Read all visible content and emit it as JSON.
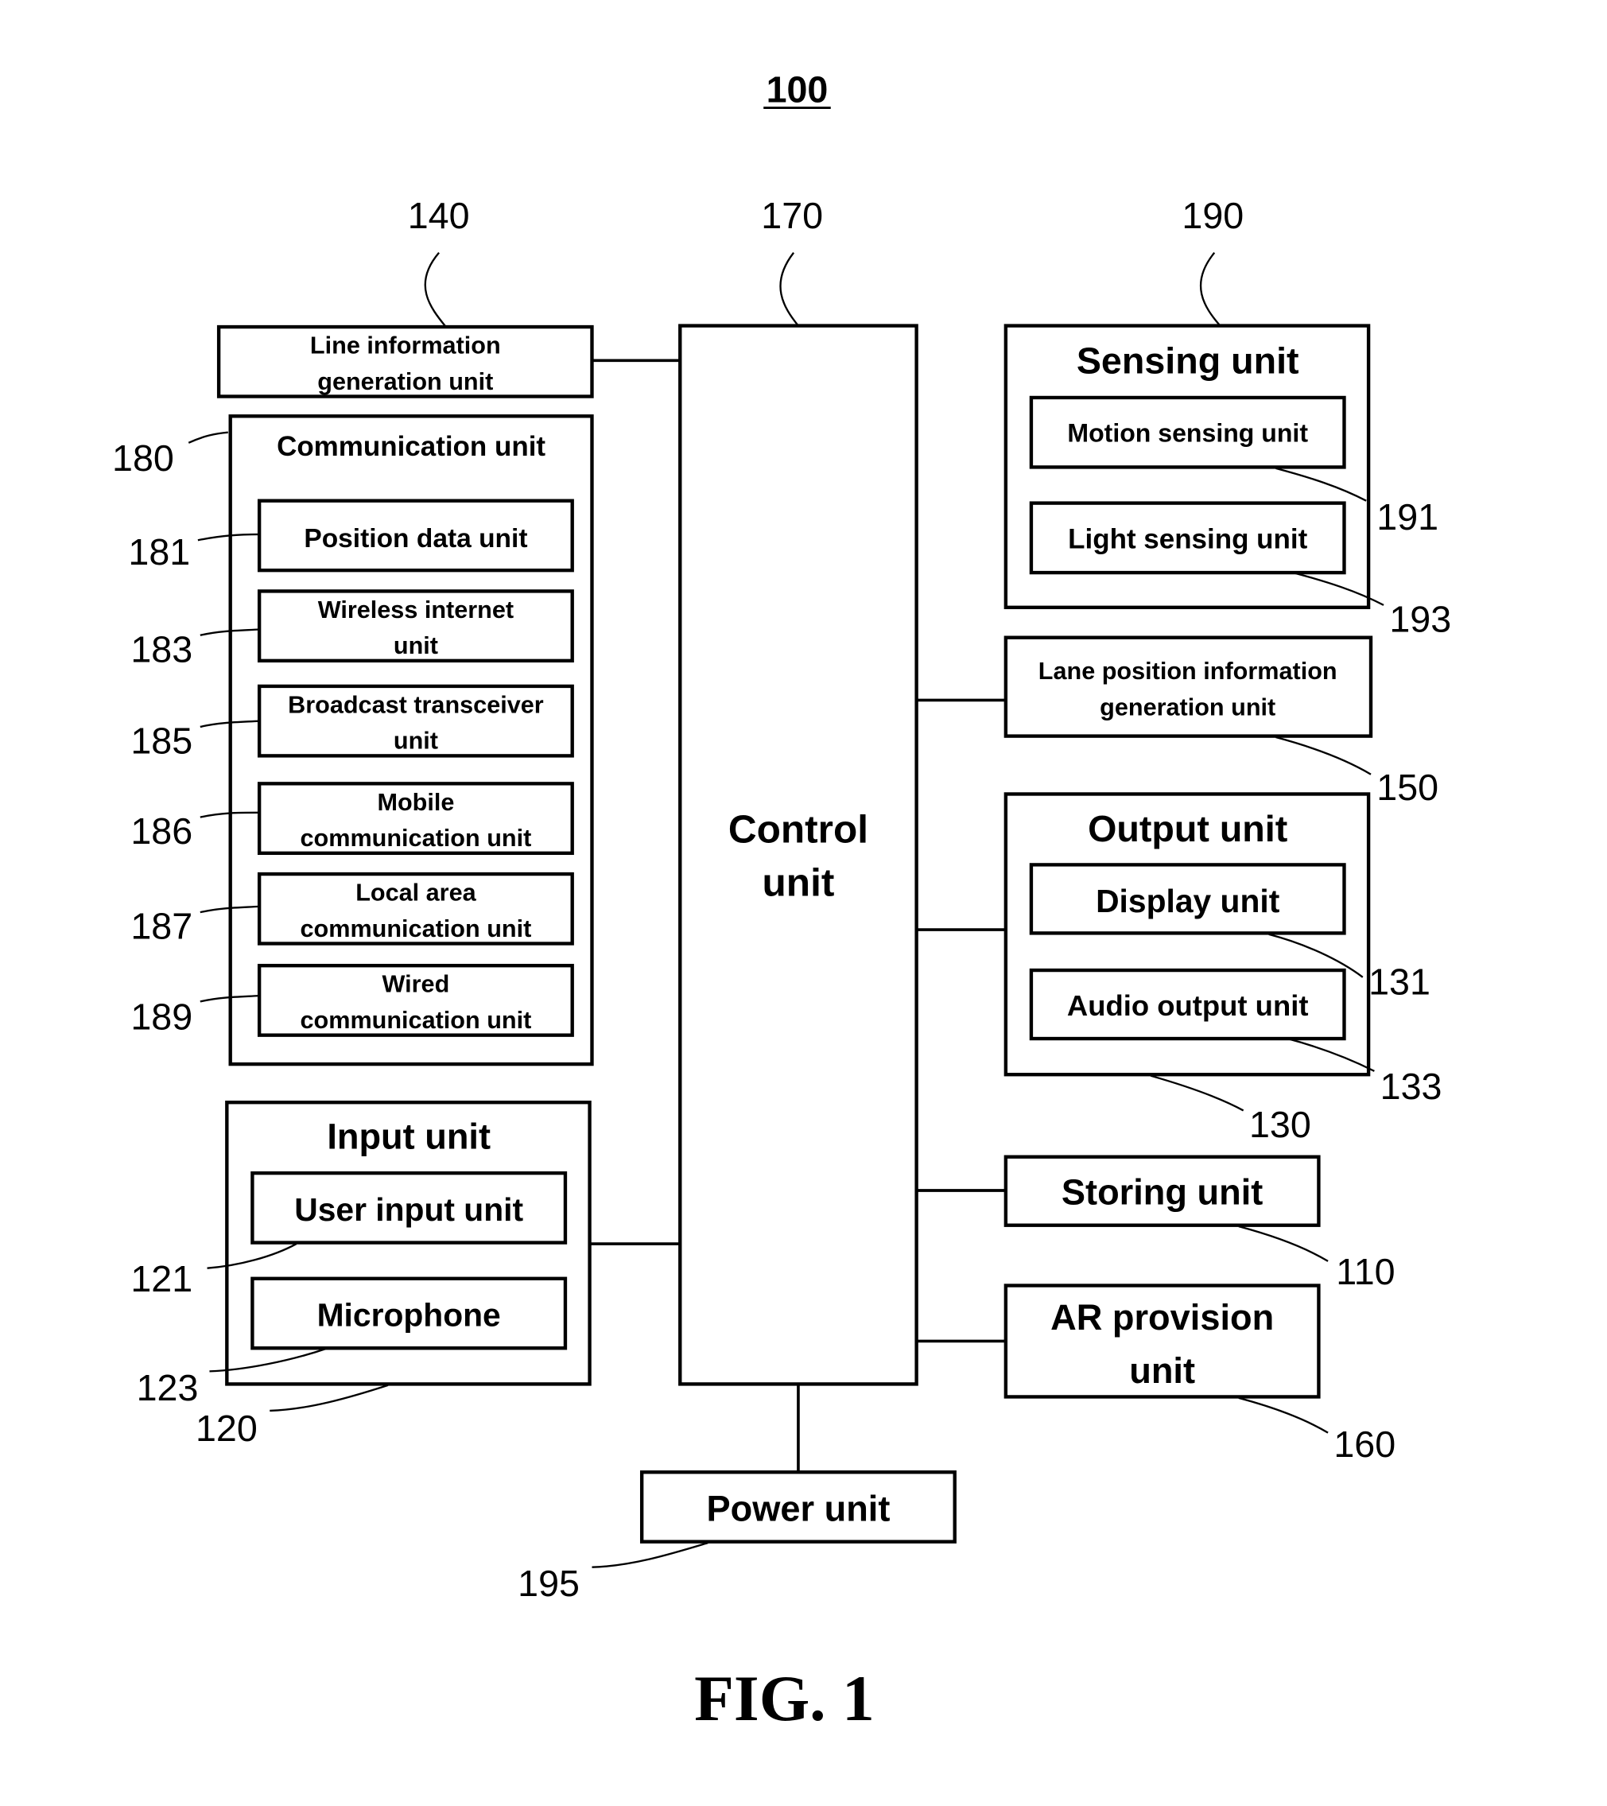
{
  "title": "100",
  "caption": "FIG. 1",
  "refs": {
    "r140": "140",
    "r170": "170",
    "r190": "190",
    "r180": "180",
    "r181": "181",
    "r183": "183",
    "r185": "185",
    "r186": "186",
    "r187": "187",
    "r189": "189",
    "r191": "191",
    "r193": "193",
    "r150": "150",
    "r131": "131",
    "r133": "133",
    "r130": "130",
    "r110": "110",
    "r160": "160",
    "r121": "121",
    "r123": "123",
    "r120": "120",
    "r195": "195"
  },
  "blocks": {
    "line_info": [
      "Line information",
      "generation unit"
    ],
    "communication": "Communication unit",
    "position_data": "Position data unit",
    "wireless": [
      "Wireless internet",
      "unit"
    ],
    "broadcast": [
      "Broadcast transceiver",
      "unit"
    ],
    "mobile": [
      "Mobile",
      "communication unit"
    ],
    "local_area": [
      "Local area",
      "communication unit"
    ],
    "wired": [
      "Wired",
      "communication unit"
    ],
    "input": "Input unit",
    "user_input": "User input unit",
    "microphone": "Microphone",
    "control": [
      "Control",
      "unit"
    ],
    "sensing": "Sensing unit",
    "motion": "Motion sensing unit",
    "light": "Light sensing unit",
    "lane_pos": [
      "Lane position information",
      "generation unit"
    ],
    "output": "Output unit",
    "display": "Display unit",
    "audio": "Audio output unit",
    "storing": "Storing unit",
    "ar": [
      "AR provision",
      "unit"
    ],
    "power": "Power unit"
  }
}
